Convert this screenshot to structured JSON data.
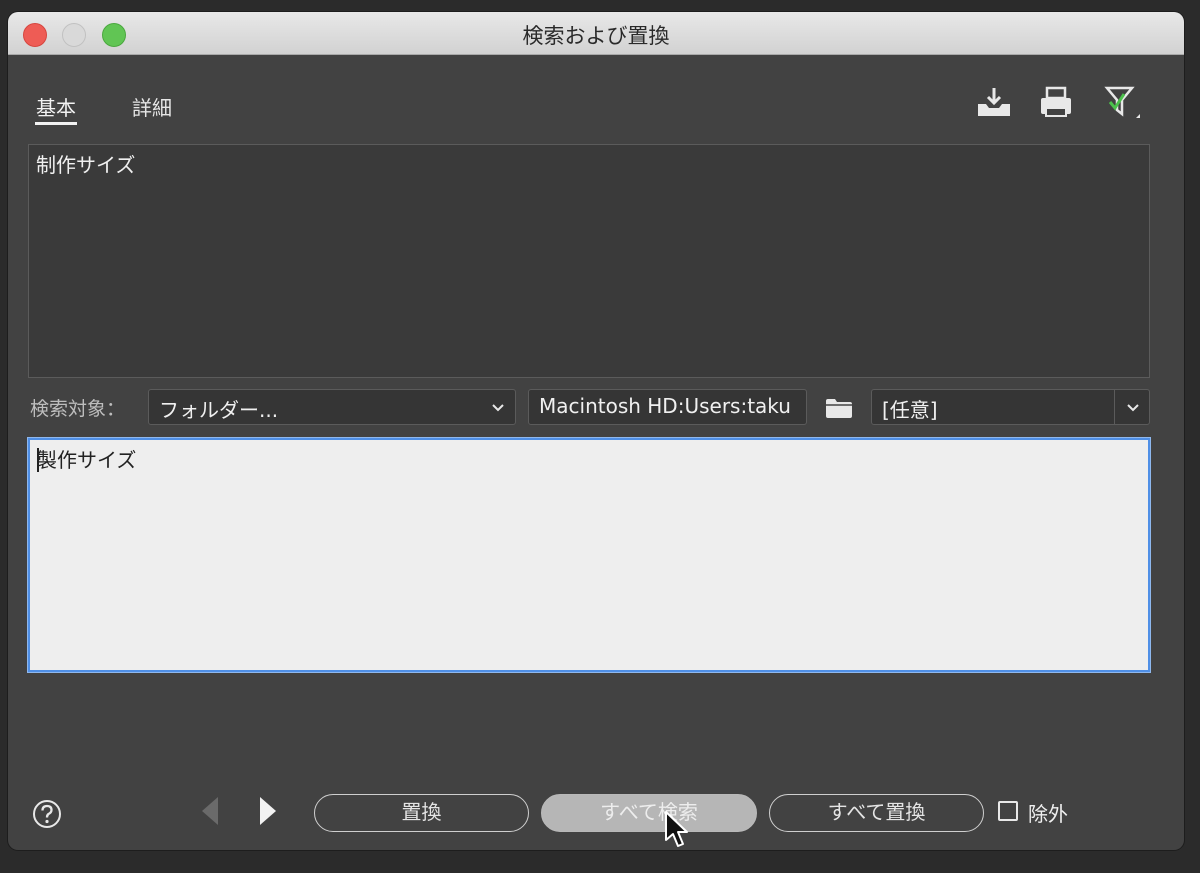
{
  "window": {
    "title": "検索および置換"
  },
  "tabs": [
    {
      "label": "基本"
    },
    {
      "label": "詳細"
    }
  ],
  "toolbar": {
    "icons": [
      "save-query-icon",
      "print-icon",
      "filter-icon"
    ]
  },
  "find": {
    "value": "制作サイズ"
  },
  "scope": {
    "label": "検索対象：",
    "target": "フォルダー...",
    "path": "Macintosh HD:Users:taku",
    "file_type": "[任意]"
  },
  "replace": {
    "value": "製作サイズ"
  },
  "footer": {
    "replace_label": "置換",
    "find_all_label": "すべて検索",
    "replace_all_label": "すべて置換",
    "exclude_label": "除外",
    "exclude_checked": false
  },
  "colors": {
    "panel_bg": "#424242",
    "focus_ring": "#4f8fe6",
    "close": "#ee5c55",
    "maximize": "#61c554"
  }
}
